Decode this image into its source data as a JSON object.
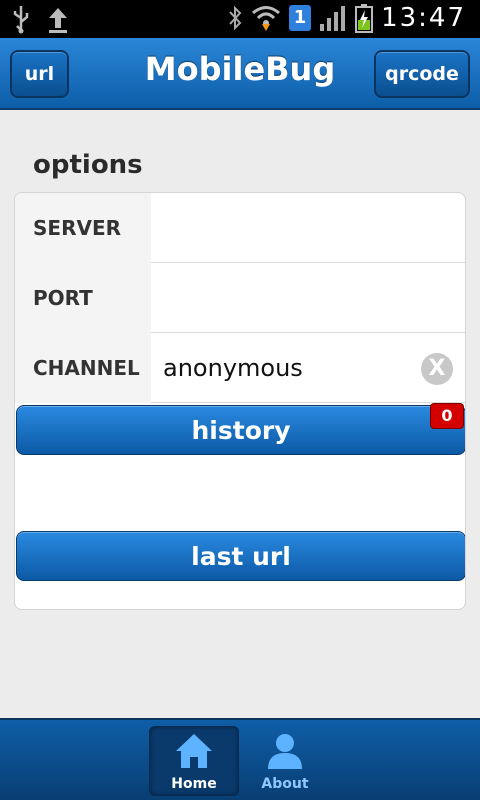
{
  "status_bar": {
    "time": "13:47",
    "notification_count": "1",
    "icons": [
      "usb-icon",
      "upload-icon",
      "bluetooth-icon",
      "wifi-icon",
      "signal-icon",
      "battery-charging-icon"
    ]
  },
  "header": {
    "title": "MobileBug",
    "left_button": "url",
    "right_button": "qrcode"
  },
  "options": {
    "title": "options",
    "fields": [
      {
        "label": "SERVER",
        "value": ""
      },
      {
        "label": "PORT",
        "value": ""
      },
      {
        "label": "CHANNEL",
        "value": "anonymous"
      }
    ],
    "clear_glyph": "X",
    "history_button": "history",
    "history_count": "0",
    "last_url_button": "last url"
  },
  "tabbar": {
    "tabs": [
      {
        "label": "Home",
        "icon": "home-icon",
        "active": true
      },
      {
        "label": "About",
        "icon": "user-icon",
        "active": false
      }
    ]
  },
  "colors": {
    "accent": "#0d5ea8",
    "badge": "#d40000"
  }
}
